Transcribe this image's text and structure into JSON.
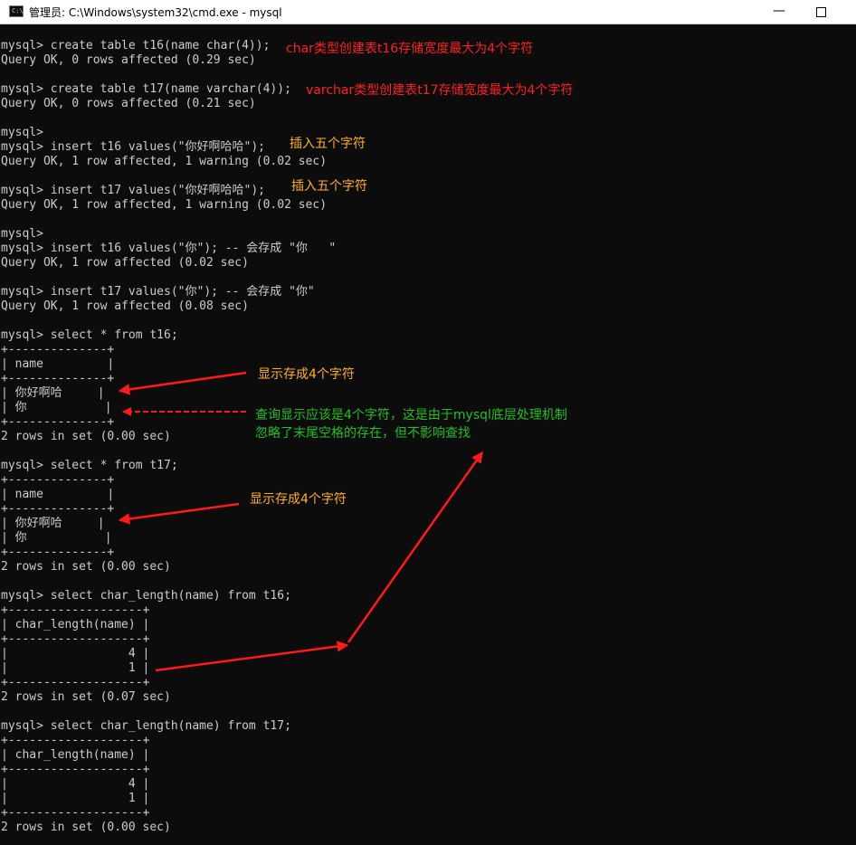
{
  "window": {
    "title": "管理员: C:\\Windows\\system32\\cmd.exe - mysql",
    "icon_label": "C:\\",
    "minimize_glyph": "—"
  },
  "console_lines": [
    "mysql> create table t16(name char(4));",
    "Query OK, 0 rows affected (0.29 sec)",
    "",
    "mysql> create table t17(name varchar(4));",
    "Query OK, 0 rows affected (0.21 sec)",
    "",
    "mysql>",
    "mysql> insert t16 values(\"你好啊哈哈\");",
    "Query OK, 1 row affected, 1 warning (0.02 sec)",
    "",
    "mysql> insert t17 values(\"你好啊哈哈\");",
    "Query OK, 1 row affected, 1 warning (0.02 sec)",
    "",
    "mysql>",
    "mysql> insert t16 values(\"你\"); -- 会存成 \"你   \"",
    "Query OK, 1 row affected (0.02 sec)",
    "",
    "mysql> insert t17 values(\"你\"); -- 会存成 \"你\"",
    "Query OK, 1 row affected (0.08 sec)",
    "",
    "mysql> select * from t16;",
    "+--------------+",
    "| name         |",
    "+--------------+",
    "| 你好啊哈     |",
    "| 你           |",
    "+--------------+",
    "2 rows in set (0.00 sec)",
    "",
    "mysql> select * from t17;",
    "+--------------+",
    "| name         |",
    "+--------------+",
    "| 你好啊哈     |",
    "| 你           |",
    "+--------------+",
    "2 rows in set (0.00 sec)",
    "",
    "mysql> select char_length(name) from t16;",
    "+-------------------+",
    "| char_length(name) |",
    "+-------------------+",
    "|                 4 |",
    "|                 1 |",
    "+-------------------+",
    "2 rows in set (0.07 sec)",
    "",
    "mysql> select char_length(name) from t17;",
    "+-------------------+",
    "| char_length(name) |",
    "+-------------------+",
    "|                 4 |",
    "|                 1 |",
    "+-------------------+",
    "2 rows in set (0.00 sec)"
  ],
  "annotations": {
    "char_note": "char类型创建表t16存储宽度最大为4个字符",
    "varchar_note": "varchar类型创建表t17存储宽度最大为4个字符",
    "insert_note_1": "插入五个字符",
    "insert_note_2": "插入五个字符",
    "display_note_1": "显示存成4个字符",
    "query_note_line1": "查询显示应该是4个字符，这是由于mysql底层处理机制",
    "query_note_line2": "忽略了末尾空格的存在，但不影响查找",
    "display_note_2": "显示存成4个字符"
  },
  "colors": {
    "terminal_bg": "#0c0c0c",
    "terminal_text": "#cccccc",
    "annotation_red": "#ff2020",
    "annotation_orange": "#ffb020",
    "annotation_green": "#22c022",
    "arrow_red": "#ff1a1a"
  }
}
